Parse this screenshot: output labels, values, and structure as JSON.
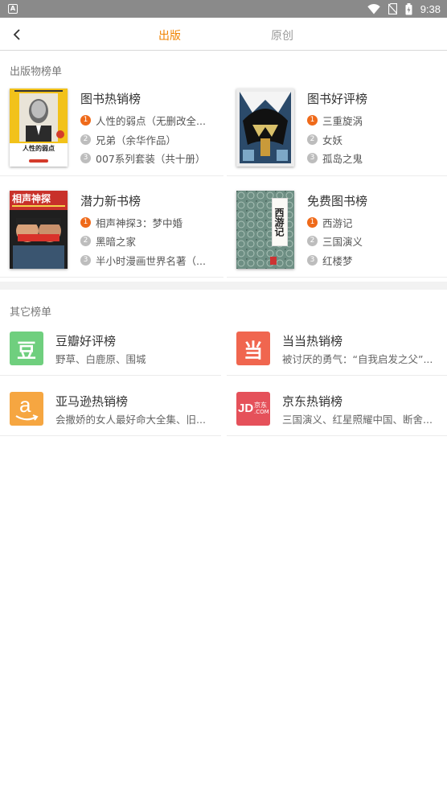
{
  "status_bar": {
    "time": "9:38",
    "app_indicator": "A"
  },
  "nav": {
    "tabs": [
      {
        "label": "出版",
        "active": true
      },
      {
        "label": "原创",
        "active": false
      }
    ]
  },
  "colors": {
    "accent": "#f08300",
    "rank_first": "#ef6a1a",
    "rank_other": "#bdbdbd"
  },
  "publish_section": {
    "header": "出版物榜单",
    "lists": [
      {
        "title": "图书热销榜",
        "cover_title": "人性的弱点",
        "items": [
          "人性的弱点（无删改全...",
          "兄弟（余华作品）",
          "007系列套装（共十册）"
        ]
      },
      {
        "title": "图书好评榜",
        "items": [
          "三重旋涡",
          "女妖",
          "孤岛之鬼"
        ]
      },
      {
        "title": "潜力新书榜",
        "cover_title": "相声神探",
        "items": [
          "相声神探3：梦中婚",
          "黑暗之家",
          "半小时漫画世界名著（..."
        ]
      },
      {
        "title": "免费图书榜",
        "cover_title": "西游记",
        "items": [
          "西游记",
          "三国演义",
          "红楼梦"
        ]
      }
    ]
  },
  "other_section": {
    "header": "其它榜单",
    "lists": [
      {
        "title": "豆瓣好评榜",
        "subtitle": "野草、白鹿原、围城",
        "logo_text": "豆",
        "logo_color": "#6fcf7e"
      },
      {
        "title": "当当热销榜",
        "subtitle": "被讨厌的勇气：“自我启发之父”...",
        "logo_text": "当",
        "logo_color": "#f0664f"
      },
      {
        "title": "亚马逊热销榜",
        "subtitle": "会撒娇的女人最好命大全集、旧...",
        "logo_text": "a",
        "logo_color": "#f6a641"
      },
      {
        "title": "京东热销榜",
        "subtitle": "三国演义、红星照耀中国、断舍...",
        "logo_text": "JD",
        "logo_text_2": "京东",
        "logo_text_3": ".COM",
        "logo_color": "#e5515a"
      }
    ]
  }
}
